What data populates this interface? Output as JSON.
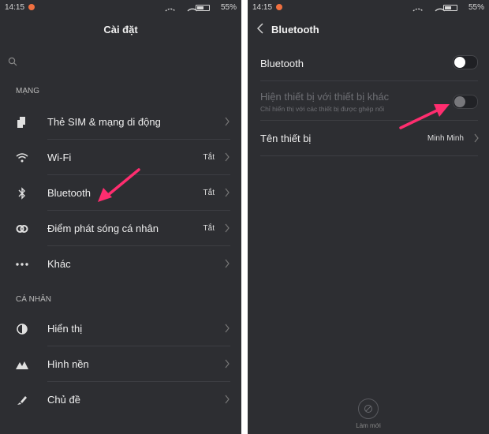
{
  "status": {
    "time": "14:15",
    "battery_pct": "55%"
  },
  "left": {
    "title": "Cài đặt",
    "section_network": "MẠNG",
    "section_personal": "CÁ NHÂN",
    "items": [
      {
        "label": "Thẻ SIM & mạng di động",
        "value": ""
      },
      {
        "label": "Wi-Fi",
        "value": "Tắt"
      },
      {
        "label": "Bluetooth",
        "value": "Tắt"
      },
      {
        "label": "Điểm phát sóng cá nhân",
        "value": "Tắt"
      },
      {
        "label": "Khác",
        "value": ""
      },
      {
        "label": "Hiển thị",
        "value": ""
      },
      {
        "label": "Hình nền",
        "value": ""
      },
      {
        "label": "Chủ đề",
        "value": ""
      }
    ]
  },
  "right": {
    "title": "Bluetooth",
    "bluetooth_label": "Bluetooth",
    "visibility_label": "Hiện thiết bị với thiết bị khác",
    "visibility_sub": "Chỉ hiển thị với các thiết bị được ghép nối",
    "device_name_label": "Tên thiết bị",
    "device_name_value": "Minh Minh",
    "refresh_label": "Làm mới"
  },
  "colors": {
    "arrow": "#ff2d6f",
    "background": "#2d2e32"
  }
}
